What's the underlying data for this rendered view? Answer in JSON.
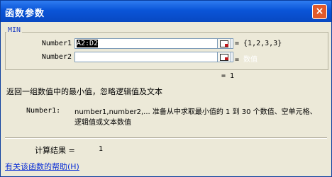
{
  "window": {
    "title": "函数参数",
    "close_glyph": "×"
  },
  "function": {
    "name": "MIN",
    "args": [
      {
        "label": "Number1",
        "value": "A2:D2",
        "result": "= {1,2,3,3}"
      },
      {
        "label": "Number2",
        "value": "",
        "result": "= ",
        "hint": "数值"
      }
    ],
    "result_line": "= 1",
    "description": "返回一组数值中的最小值，忽略逻辑值及文本",
    "arg_help_name": "Number1:",
    "arg_help_text": "number1,number2,... 准备从中求取最小值的 1 到 30 个数值、空单元格、逻辑值或文本数值"
  },
  "footer": {
    "calc_label": "计算结果 =",
    "calc_value": "1",
    "help_link": "有关该函数的帮助(H)"
  },
  "icons": {
    "ref_button": "cell-reference-icon"
  },
  "colors": {
    "titlebar": "#0a55d8",
    "dialog_bg": "#ece9d8",
    "group_label": "#1b3cc2",
    "link": "#0b2fd6"
  }
}
